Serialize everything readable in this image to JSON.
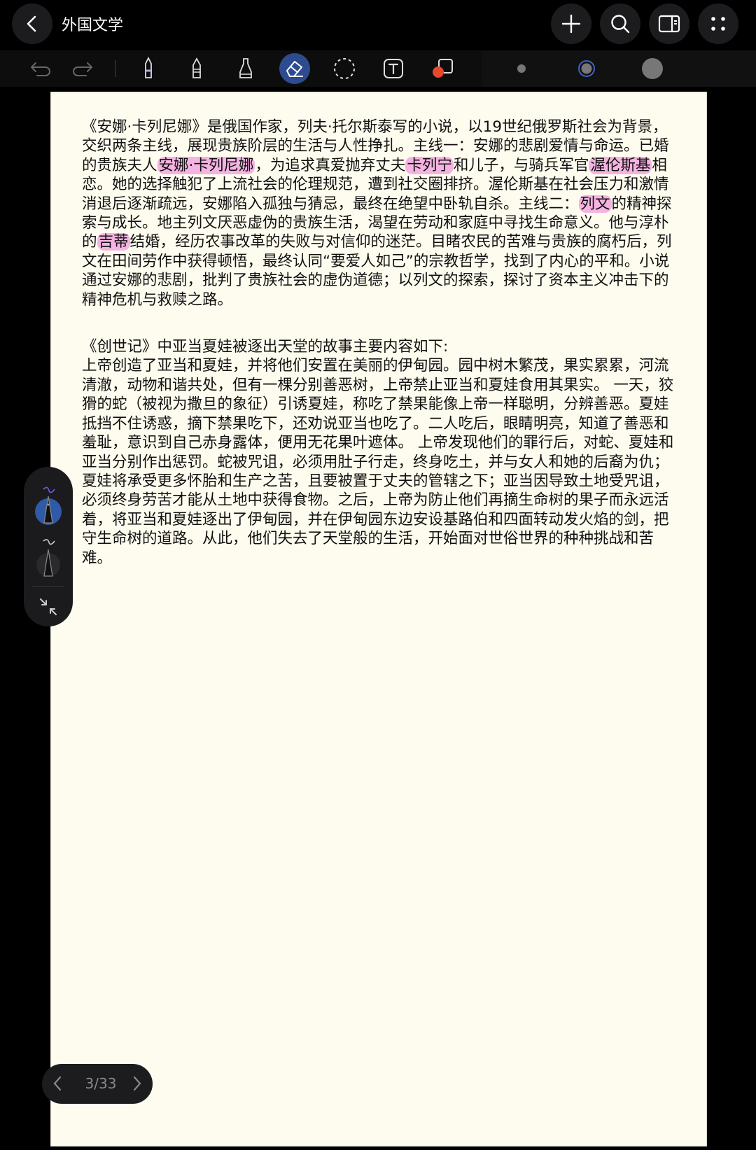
{
  "app": {
    "title": "外国文学"
  },
  "toolbar": {
    "icons": [
      "undo-icon",
      "redo-icon",
      "pen-icon",
      "ballpoint-icon",
      "highlighter-icon",
      "eraser-icon",
      "lasso-icon",
      "text-box-icon",
      "shapes-icon"
    ],
    "active_tool": "eraser",
    "sizes": [
      "small",
      "medium",
      "large"
    ],
    "selected_size": "medium"
  },
  "document": {
    "paragraph1": {
      "p1": "《安娜·卡列尼娜》是俄国作家，列夫·托尔斯泰写的小说，以19世纪俄罗斯社会为背景，交织两条主线，展现贵族阶层的生活与人性挣扎。主线一：安娜的悲剧爱情与命运。已婚的贵族夫人",
      "h1": "安娜·卡列尼娜",
      "p2": "，为追求真爱抛弃丈夫",
      "h2": "卡列宁",
      "p3": "和儿子，与骑兵军官",
      "h3": "渥伦斯基",
      "p4": "相恋。她的选择触犯了上流社会的伦理规范，遭到社交圈排挤。渥伦斯基在社会压力和激情消退后逐渐疏远，安娜陷入孤独与猜忌，最终在绝望中卧轨自杀。主线二：",
      "h4": "列文",
      "p5": "的精神探索与成长。地主列文厌恶虚伪的贵族生活，渴望在劳动和家庭中寻找生命意义。他与淳朴的",
      "h5": "吉蒂",
      "p6": "结婚，经历农事改革的失败与对信仰的迷茫。目睹农民的苦难与贵族的腐朽后，列文在田间劳作中获得顿悟，最终认同“要爱人如己”的宗教哲学，找到了内心的平和。小说通过安娜的悲剧，批判了贵族社会的虚伪道德；以列文的探索，探讨了资本主义冲击下的精神危机与救赎之路。"
    },
    "paragraph2_heading": "《创世记》中亚当夏娃被逐出天堂的故事主要内容如下:",
    "paragraph2_body": "上帝创造了亚当和夏娃，并将他们安置在美丽的伊甸园。园中树木繁茂，果实累累，河流清澈，动物和谐共处，但有一棵分别善恶树，上帝禁止亚当和夏娃食用其果实。 一天，狡猾的蛇（被视为撒旦的象征）引诱夏娃，称吃了禁果能像上帝一样聪明，分辨善恶。夏娃抵挡不住诱惑，摘下禁果吃下，还劝说亚当也吃了。二人吃后，眼睛明亮，知道了善恶和羞耻，意识到自己赤身露体，便用无花果叶遮体。 上帝发现他们的罪行后，对蛇、夏娃和亚当分别作出惩罚。蛇被咒诅，必须用肚子行走，终身吃土，并与女人和她的后裔为仇；夏娃将承受更多怀胎和生产之苦，且要被置于丈夫的管辖之下；亚当因导致土地受咒诅，必须终身劳苦才能从土地中获得食物。之后，上帝为防止他们再摘生命树的果子而永远活着，将亚当和夏娃逐出了伊甸园，并在伊甸园东边安设基路伯和四面转动发火焰的剑，把守生命树的道路。从此，他们失去了天堂般的生活，开始面对世俗世界的种种挑战和苦难。"
  },
  "pager": {
    "label": "3/33"
  },
  "colors": {
    "highlight": "#f5b3e2",
    "page": "#fefcee",
    "active_tool": "#2d4b8f"
  }
}
